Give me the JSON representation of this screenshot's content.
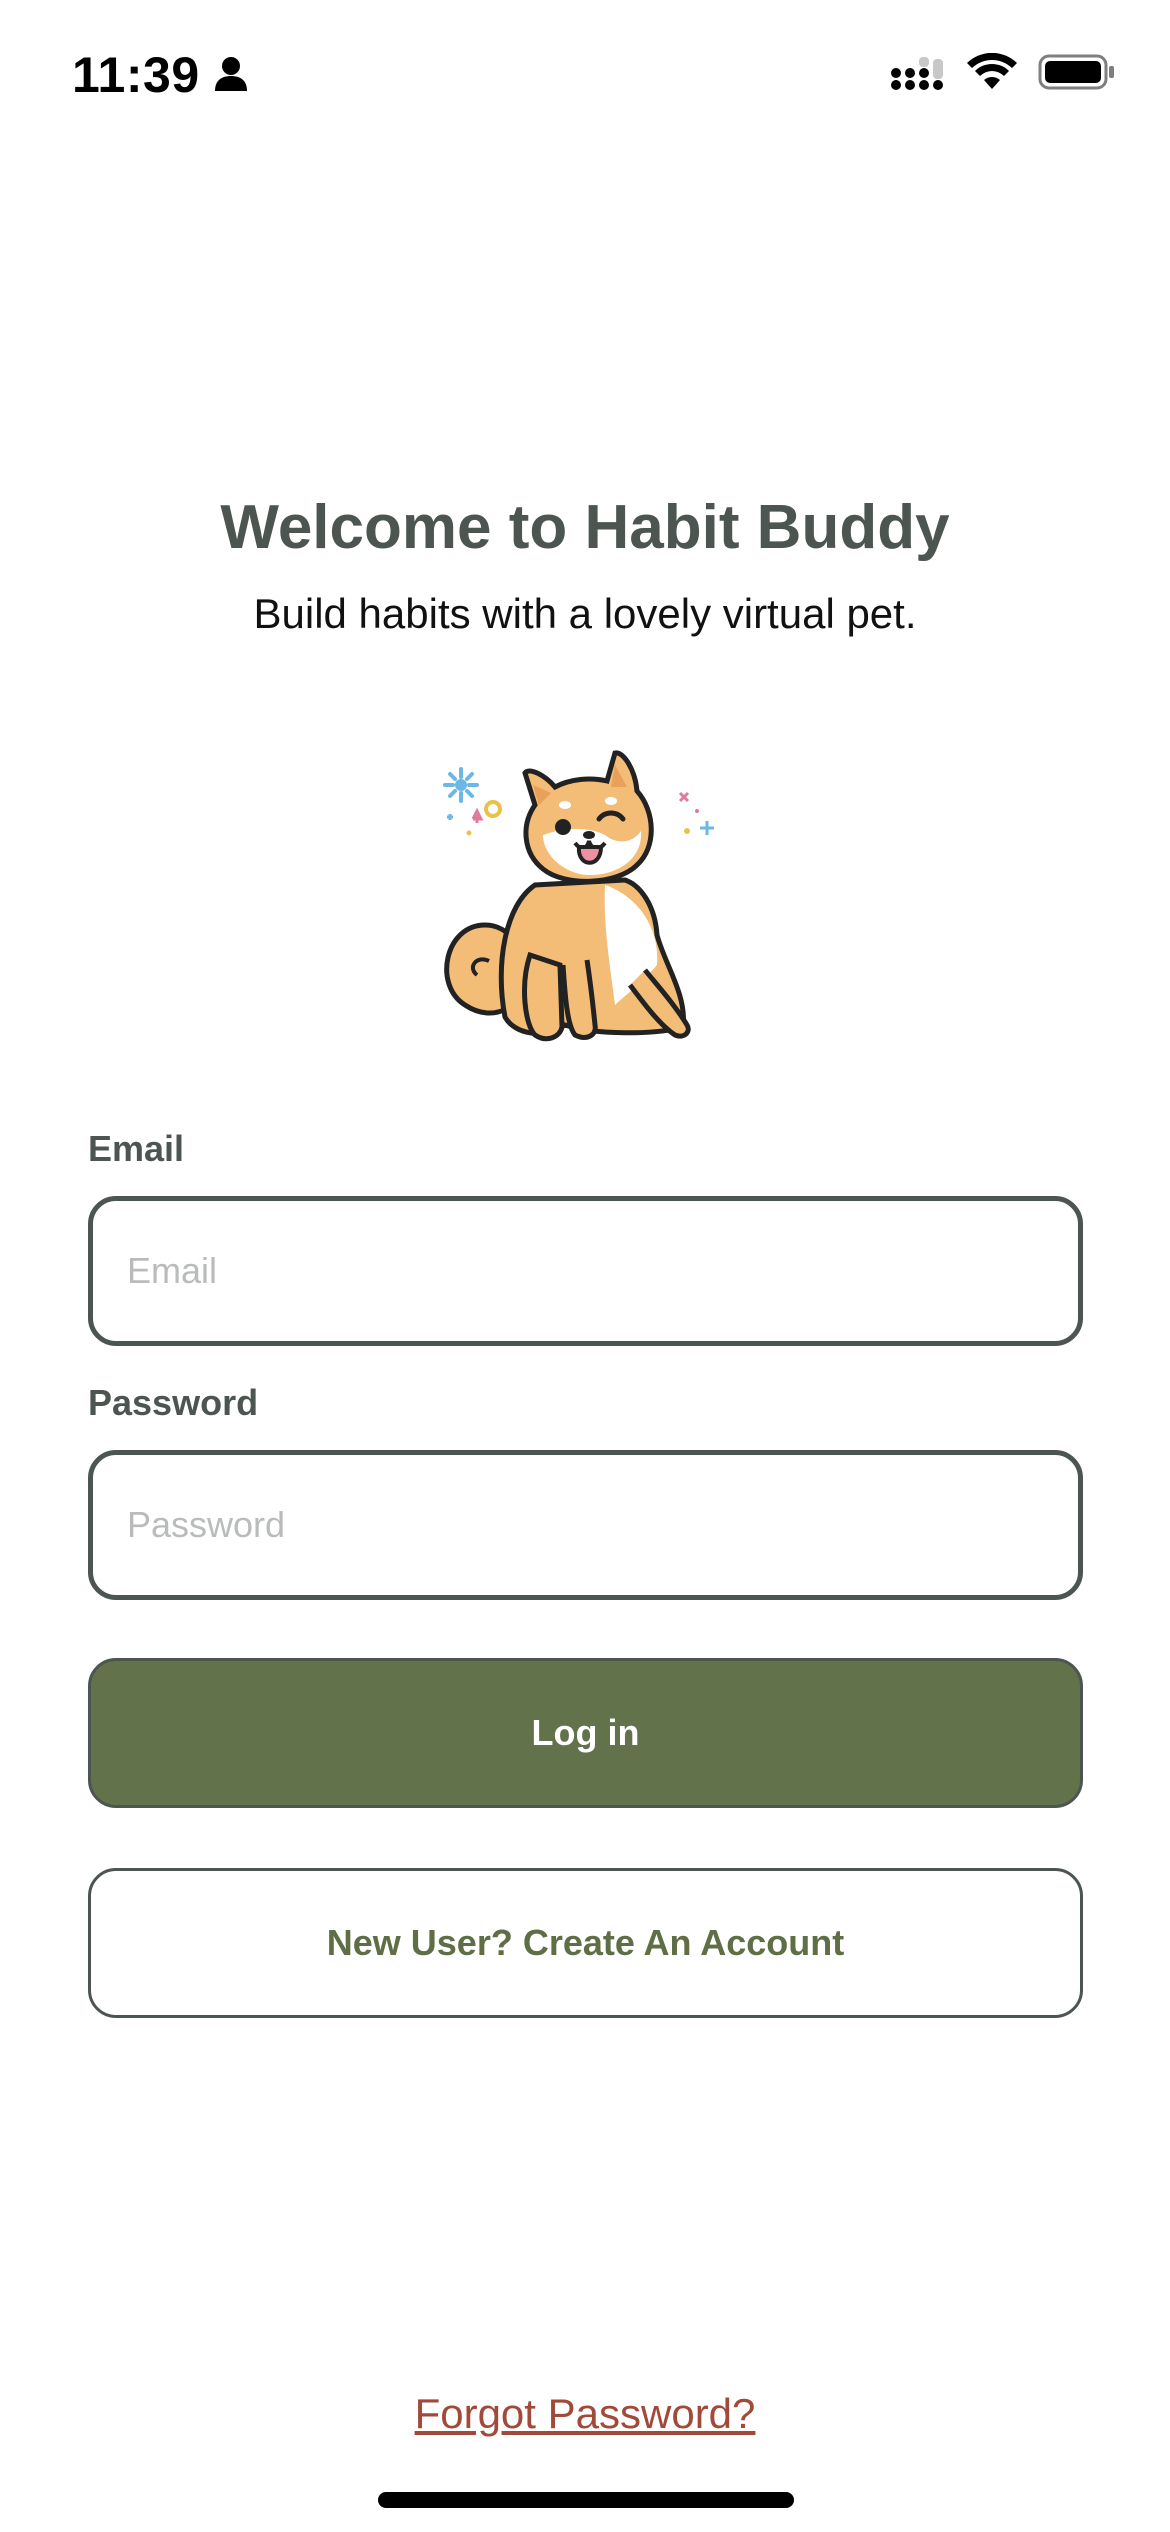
{
  "status_bar": {
    "time": "11:39",
    "icons": [
      "person-icon",
      "cellular-signal-icon",
      "wifi-icon",
      "battery-icon"
    ]
  },
  "header": {
    "title": "Welcome to Habit Buddy",
    "subtitle": "Build habits with a lovely virtual pet."
  },
  "mascot": {
    "icon": "shiba-dog-mascot"
  },
  "form": {
    "email_label": "Email",
    "email_placeholder": "Email",
    "email_value": "",
    "password_label": "Password",
    "password_placeholder": "Password",
    "password_value": ""
  },
  "buttons": {
    "login_label": "Log in",
    "create_account_label": "New User? Create An Account"
  },
  "links": {
    "forgot_password": "Forgot Password?"
  },
  "colors": {
    "primary_green": "#62724b",
    "text_gray": "#4c5550",
    "link_red": "#a24a3a"
  }
}
